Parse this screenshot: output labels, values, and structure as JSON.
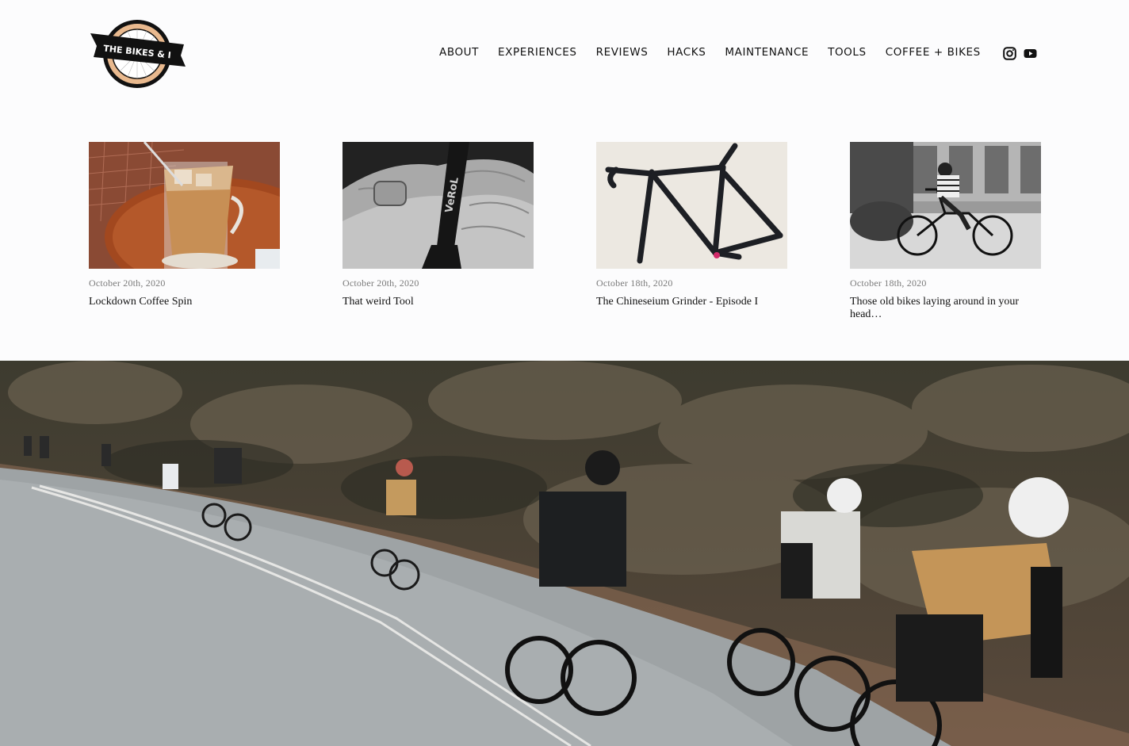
{
  "site": {
    "logo_text": "THE BIKES & I"
  },
  "nav": {
    "items": [
      {
        "label": "ABOUT"
      },
      {
        "label": "EXPERIENCES"
      },
      {
        "label": "REVIEWS"
      },
      {
        "label": "HACKS"
      },
      {
        "label": "MAINTENANCE"
      },
      {
        "label": "TOOLS"
      },
      {
        "label": "COFFEE + BIKES"
      }
    ]
  },
  "social": {
    "icons": [
      "instagram-icon",
      "youtube-icon"
    ]
  },
  "posts": [
    {
      "date": "October 20th, 2020",
      "title": "Lockdown Coffee Spin",
      "image": "iced-coffee-photo"
    },
    {
      "date": "October 20th, 2020",
      "title": "That weird Tool",
      "image": "spanner-tool-photo"
    },
    {
      "date": "October 18th, 2020",
      "title": "The Chineseium Grinder - Episode I",
      "image": "bike-frame-photo"
    },
    {
      "date": "October 18th, 2020",
      "title": "Those old bikes laying around in your head…",
      "image": "boy-on-bike-photo"
    }
  ],
  "hero": {
    "image": "group-cyclists-road-photo"
  },
  "colors": {
    "background": "#fcfcfd",
    "text": "#111111",
    "date_text": "#7a7a7a",
    "logo_wheel": "#e9b98e"
  }
}
